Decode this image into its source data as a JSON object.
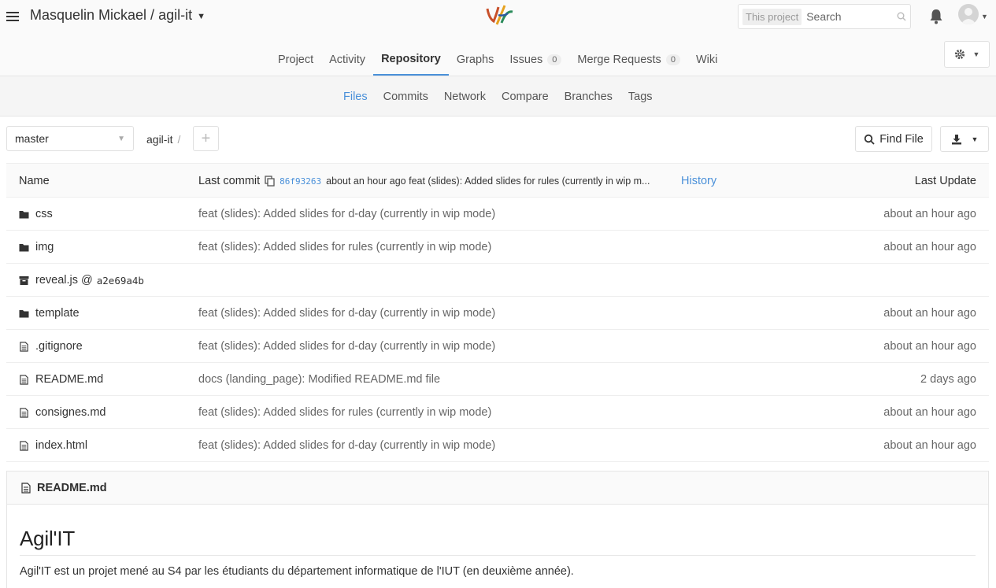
{
  "header": {
    "project_title": "Masquelin Mickael / agil-it",
    "search_scope": "This project",
    "search_placeholder": "Search"
  },
  "main_nav": [
    {
      "label": "Project"
    },
    {
      "label": "Activity"
    },
    {
      "label": "Repository",
      "active": true
    },
    {
      "label": "Graphs"
    },
    {
      "label": "Issues",
      "badge": "0"
    },
    {
      "label": "Merge Requests",
      "badge": "0"
    },
    {
      "label": "Wiki"
    }
  ],
  "sub_nav": [
    {
      "label": "Files",
      "active": true
    },
    {
      "label": "Commits"
    },
    {
      "label": "Network"
    },
    {
      "label": "Compare"
    },
    {
      "label": "Branches"
    },
    {
      "label": "Tags"
    }
  ],
  "toolbar": {
    "branch": "master",
    "path_root": "agil-it",
    "path_sep": "/",
    "find_file_label": "Find File"
  },
  "tree": {
    "col_name": "Name",
    "col_last_commit": "Last commit",
    "commit_sha": "86f93263",
    "commit_summary": "about an hour ago feat (slides): Added slides for rules (currently in wip m...",
    "history_label": "History",
    "col_last_update": "Last Update",
    "rows": [
      {
        "name": "css",
        "type": "folder",
        "message": "feat (slides): Added slides for d-day (currently in wip mode)",
        "date": "about an hour ago"
      },
      {
        "name": "img",
        "type": "folder",
        "message": "feat (slides): Added slides for rules (currently in wip mode)",
        "date": "about an hour ago"
      },
      {
        "name": "reveal.js @",
        "type": "submodule",
        "submodule_sha": "a2e69a4b",
        "message": "",
        "date": ""
      },
      {
        "name": "template",
        "type": "folder",
        "message": "feat (slides): Added slides for d-day (currently in wip mode)",
        "date": "about an hour ago"
      },
      {
        "name": ".gitignore",
        "type": "file",
        "message": "feat (slides): Added slides for d-day (currently in wip mode)",
        "date": "about an hour ago"
      },
      {
        "name": "README.md",
        "type": "file",
        "message": "docs (landing_page): Modified README.md file",
        "date": "2 days ago"
      },
      {
        "name": "consignes.md",
        "type": "file",
        "message": "feat (slides): Added slides for rules (currently in wip mode)",
        "date": "about an hour ago"
      },
      {
        "name": "index.html",
        "type": "file",
        "message": "feat (slides): Added slides for d-day (currently in wip mode)",
        "date": "about an hour ago"
      }
    ]
  },
  "readme": {
    "filename": "README.md",
    "heading": "Agil'IT",
    "paragraph": "Agil'IT est un projet mené au S4 par les étudiants du département informatique de l'IUT (en deuxième année)."
  },
  "colors": {
    "accent": "#4a90d9",
    "header_bg": "#fafafa"
  }
}
